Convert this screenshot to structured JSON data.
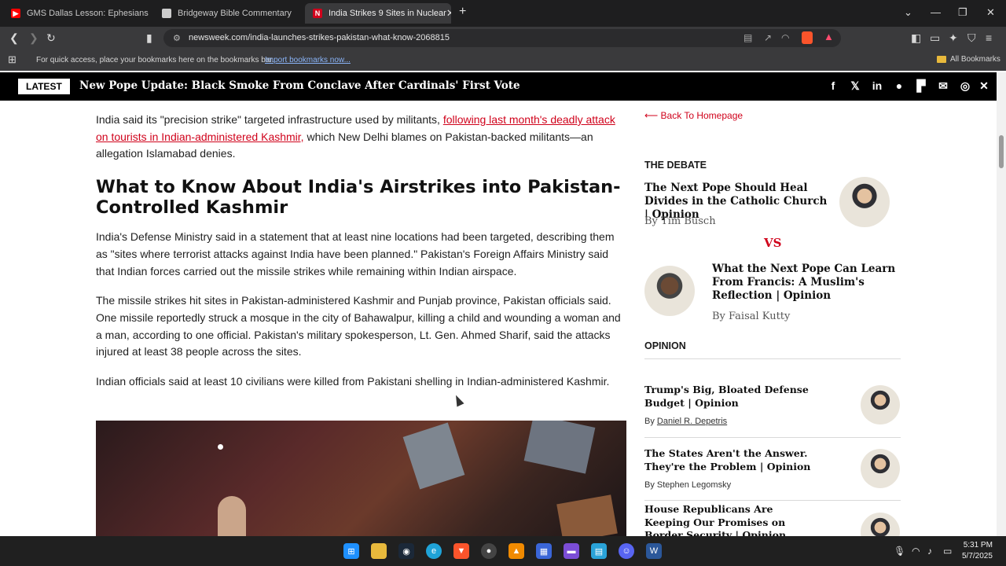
{
  "browser": {
    "tabs": [
      {
        "label": "GMS Dallas Lesson: Ephesians Chap",
        "icon": "youtube-icon",
        "color": "#ff0000"
      },
      {
        "label": "Bridgeway Bible Commentary",
        "icon": "book-icon",
        "color": "#cccccc"
      },
      {
        "label": "India Strikes 9 Sites in Nuclear",
        "icon": "newsweek-icon",
        "color": "#d0021b",
        "glyph": "N"
      }
    ],
    "new_tab": "+",
    "url": "newsweek.com/india-launches-strikes-pakistan-what-know-2068815",
    "bookmarks_message": "For quick access, place your bookmarks here on the bookmarks bar.",
    "import_link": "Import bookmarks now...",
    "all_bookmarks": "All Bookmarks"
  },
  "ticker": {
    "badge": "LATEST",
    "headline": "New Pope Update: Black Smoke From Conclave After Cardinals' First Vote",
    "share_icons": [
      "facebook-icon",
      "x-icon",
      "linkedin-icon",
      "reddit-icon",
      "flipboard-icon",
      "email-icon",
      "whatsapp-icon",
      "close-icon"
    ]
  },
  "article": {
    "p1_before": "India said its \"precision strike\" targeted infrastructure used by militants, ",
    "p1_link": "following last month's deadly attack on tourists in Indian-administered Kashmir,",
    "p1_after": " which New Delhi blames on Pakistan-backed militants—an allegation Islamabad denies.",
    "heading": "What to Know About India's Airstrikes into Pakistan-Controlled Kashmir",
    "p2": "India's Defense Ministry said in a statement that at least nine locations had been targeted, describing them as \"sites where terrorist attacks against India have been planned.\" Pakistan's Foreign Affairs Ministry said that Indian forces carried out the missile strikes while remaining within Indian airspace.",
    "p3": "The missile strikes hit sites in Pakistan-administered Kashmir and Punjab province, Pakistan officials said. One missile reportedly struck a mosque in the city of Bahawalpur, killing a child and wounding a woman and a man, according to one official. Pakistan's military spokesperson, Lt. Gen. Ahmed Sharif, said the attacks injured at least 38 people across the sites.",
    "p4": "Indian officials said at least 10 civilians were killed from Pakistani shelling in Indian-administered Kashmir."
  },
  "sidebar": {
    "back": "⟵ Back To Homepage",
    "debate_label": "THE DEBATE",
    "debate1_title": "The Next Pope Should Heal Divides in the Catholic Church | Opinion",
    "debate1_by": "By Tim Busch",
    "vs": "VS",
    "debate2_title": "What the Next Pope Can Learn From Francis: A Muslim's Reflection | Opinion",
    "debate2_by": "By Faisal Kutty",
    "opinion_label": "OPINION",
    "opinions": [
      {
        "title": "Trump's Big, Bloated Defense Budget | Opinion",
        "by": "By ",
        "name": "Daniel R. Depetris"
      },
      {
        "title": "The States Aren't the Answer. They're the Problem | Opinion",
        "by": "By Stephen Legomsky",
        "name": ""
      },
      {
        "title": "House Republicans Are Keeping Our Promises on Border Security | Opinion",
        "by": "",
        "name": ""
      }
    ]
  },
  "taskbar": {
    "time": "5:31 PM",
    "date": "5/7/2025"
  }
}
